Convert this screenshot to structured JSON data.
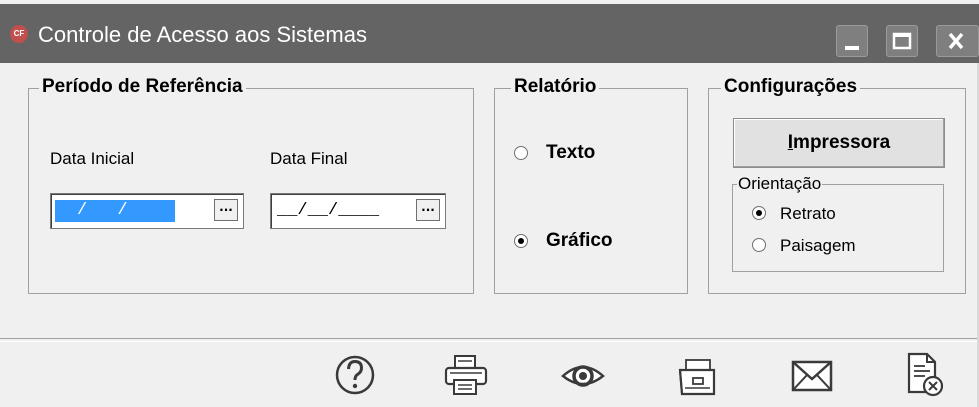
{
  "window": {
    "title": "Controle de Acesso aos Sistemas",
    "app_icon_text": "CF",
    "colors": {
      "titlebar": "#646464",
      "selection": "#3399ff"
    }
  },
  "periodo": {
    "title": "Período de Referência",
    "data_inicial_label": "Data Inicial",
    "data_inicial_value": "__/__/____",
    "data_inicial_display": "/ /",
    "data_final_label": "Data Final",
    "data_final_value": "__/__/____",
    "picker_label": "..."
  },
  "relatorio": {
    "title": "Relatório",
    "options": [
      {
        "label": "Texto",
        "checked": false
      },
      {
        "label": "Gráfico",
        "checked": true
      }
    ]
  },
  "configuracoes": {
    "title": "Configurações",
    "impressora_first": "I",
    "impressora_rest": "mpressora",
    "orientacao": {
      "title": "Orientação",
      "options": [
        {
          "label": "Retrato",
          "checked": true
        },
        {
          "label": "Paisagem",
          "checked": false
        }
      ]
    }
  },
  "toolbar": {
    "icons": [
      "help-icon",
      "printer-icon",
      "preview-eye-icon",
      "open-folder-icon",
      "email-icon",
      "close-report-icon"
    ]
  }
}
